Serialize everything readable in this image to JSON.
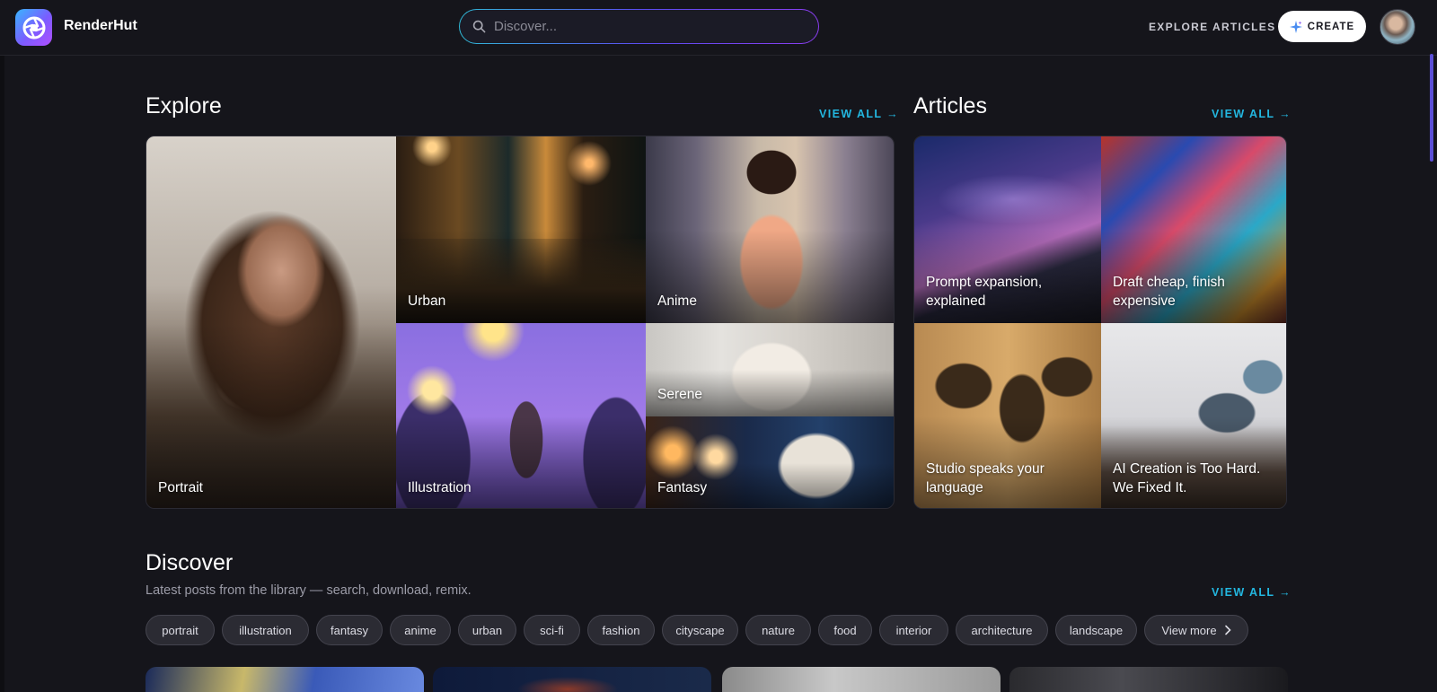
{
  "header": {
    "brand": "RenderHut",
    "search_placeholder": "Discover...",
    "nav": {
      "explore": "EXPLORE",
      "articles": "ARTICLES"
    },
    "create_label": "CREATE"
  },
  "explore": {
    "title": "Explore",
    "view_all": "VIEW ALL →",
    "tiles": {
      "portrait": "Portrait",
      "urban": "Urban",
      "anime": "Anime",
      "illustration": "Illustration",
      "serene": "Serene",
      "fantasy": "Fantasy"
    }
  },
  "articles": {
    "title": "Articles",
    "view_all": "VIEW ALL →",
    "tiles": {
      "a1": "Prompt expansion, explained",
      "a2": "Draft cheap, finish expensive",
      "a3": "Studio speaks your language",
      "a4": "AI Creation is Too Hard. We Fixed It."
    }
  },
  "discover": {
    "title": "Discover",
    "subtitle": "Latest posts from the library — search, download, remix.",
    "view_all": "VIEW ALL →",
    "chips": [
      "portrait",
      "illustration",
      "fantasy",
      "anime",
      "urban",
      "sci-fi",
      "fashion",
      "cityscape",
      "nature",
      "food",
      "interior",
      "architecture",
      "landscape"
    ],
    "view_more": "View more"
  },
  "colors": {
    "accent": "#23b7e0",
    "background": "#15151b",
    "chip": "#2b2b33"
  },
  "icons": {
    "logo": "aperture-icon",
    "search": "search-icon",
    "create": "sparkle-icon",
    "view_more": "chevron-right-icon"
  }
}
